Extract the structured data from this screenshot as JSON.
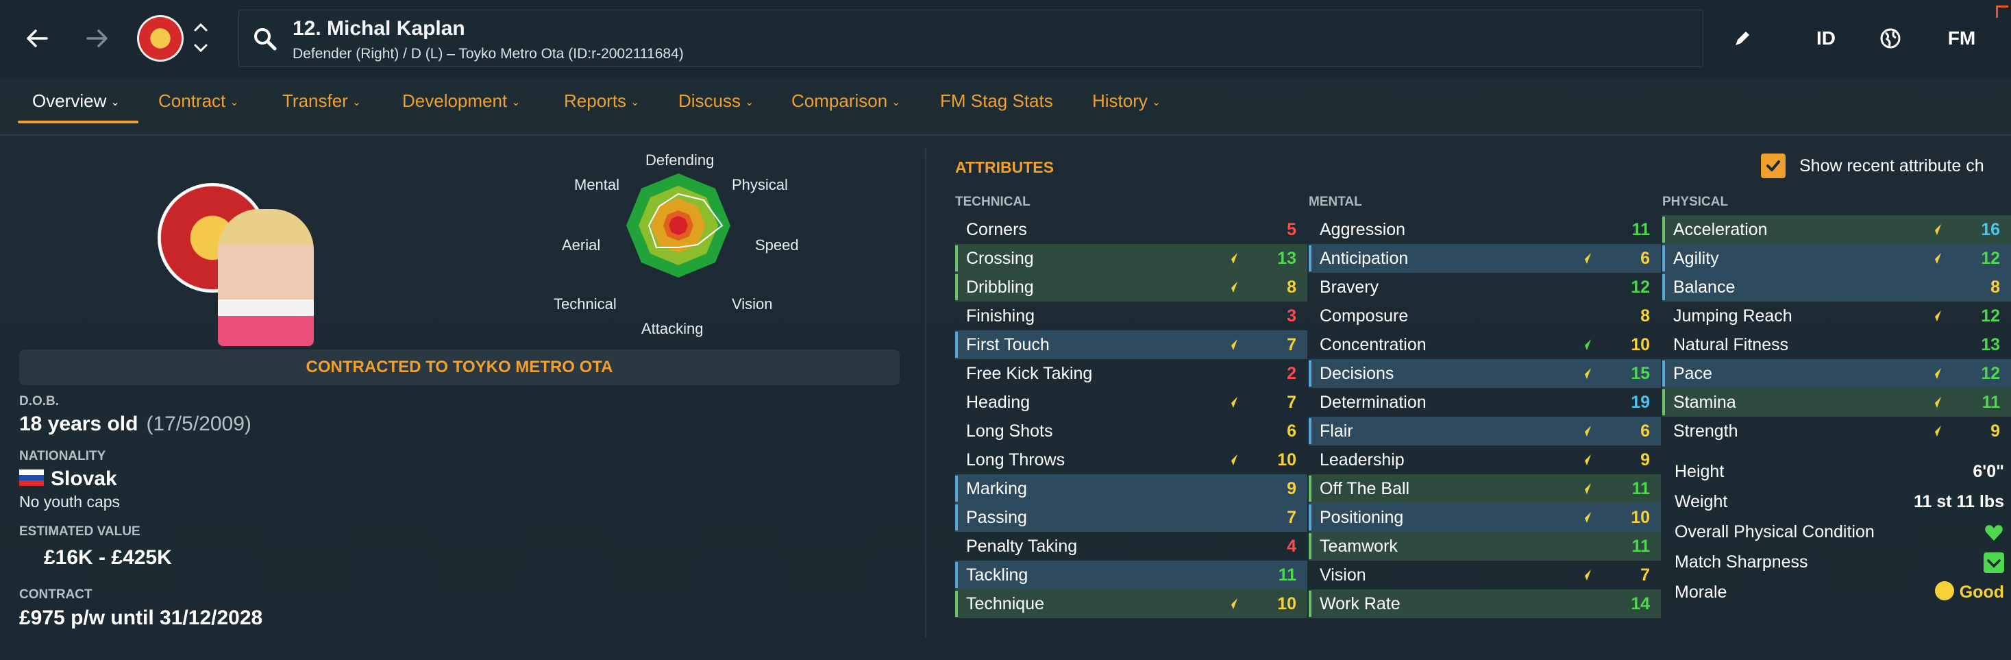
{
  "header": {
    "player_name": "12. Michal Kaplan",
    "player_subtitle": "Defender (Right) / D (L) – Toyko Metro Ota (ID:r-2002111684)",
    "id_button": "ID",
    "fm_button": "FM"
  },
  "tabs": [
    {
      "label": "Overview"
    },
    {
      "label": "Contract"
    },
    {
      "label": "Transfer"
    },
    {
      "label": "Development"
    },
    {
      "label": "Reports"
    },
    {
      "label": "Discuss"
    },
    {
      "label": "Comparison"
    },
    {
      "label": "FM Stag Stats"
    },
    {
      "label": "History"
    }
  ],
  "radar": {
    "labels": {
      "defending": "Defending",
      "physical": "Physical",
      "speed": "Speed",
      "vision": "Vision",
      "attacking": "Attacking",
      "technical": "Technical",
      "aerial": "Aerial",
      "mental": "Mental"
    }
  },
  "profile": {
    "contract_banner": "CONTRACTED TO TOYKO METRO OTA",
    "dob_label": "D.O.B.",
    "age": "18 years old",
    "dob": "(17/5/2009)",
    "nationality_label": "NATIONALITY",
    "nationality": "Slovak",
    "youth_caps": "No youth caps",
    "value_label": "ESTIMATED VALUE",
    "value": "£16K - £425K",
    "contract_label": "CONTRACT",
    "contract": "£975 p/w until 31/12/2028"
  },
  "attributes": {
    "title": "ATTRIBUTES",
    "show_recent_label": "Show recent attribute ch",
    "technical_head": "TECHNICAL",
    "mental_head": "MENTAL",
    "physical_head": "PHYSICAL",
    "technical": [
      {
        "name": "Corners",
        "value": "5",
        "color": "red",
        "hl": "",
        "arrow": ""
      },
      {
        "name": "Crossing",
        "value": "13",
        "color": "green",
        "hl": "green",
        "arrow": "up"
      },
      {
        "name": "Dribbling",
        "value": "8",
        "color": "yellow",
        "hl": "green",
        "arrow": "up"
      },
      {
        "name": "Finishing",
        "value": "3",
        "color": "red",
        "hl": "",
        "arrow": ""
      },
      {
        "name": "First Touch",
        "value": "7",
        "color": "yellow",
        "hl": "blue",
        "arrow": "up"
      },
      {
        "name": "Free Kick Taking",
        "value": "2",
        "color": "red",
        "hl": "",
        "arrow": ""
      },
      {
        "name": "Heading",
        "value": "7",
        "color": "yellow",
        "hl": "",
        "arrow": "up"
      },
      {
        "name": "Long Shots",
        "value": "6",
        "color": "yellow",
        "hl": "",
        "arrow": ""
      },
      {
        "name": "Long Throws",
        "value": "10",
        "color": "yellow",
        "hl": "",
        "arrow": "up"
      },
      {
        "name": "Marking",
        "value": "9",
        "color": "yellow",
        "hl": "blue",
        "arrow": ""
      },
      {
        "name": "Passing",
        "value": "7",
        "color": "yellow",
        "hl": "blue",
        "arrow": ""
      },
      {
        "name": "Penalty Taking",
        "value": "4",
        "color": "red",
        "hl": "",
        "arrow": ""
      },
      {
        "name": "Tackling",
        "value": "11",
        "color": "green",
        "hl": "blue",
        "arrow": ""
      },
      {
        "name": "Technique",
        "value": "10",
        "color": "yellow",
        "hl": "green",
        "arrow": "up"
      }
    ],
    "mental": [
      {
        "name": "Aggression",
        "value": "11",
        "color": "green",
        "hl": "",
        "arrow": ""
      },
      {
        "name": "Anticipation",
        "value": "6",
        "color": "yellow",
        "hl": "blue",
        "arrow": "up"
      },
      {
        "name": "Bravery",
        "value": "12",
        "color": "green",
        "hl": "",
        "arrow": ""
      },
      {
        "name": "Composure",
        "value": "8",
        "color": "yellow",
        "hl": "",
        "arrow": ""
      },
      {
        "name": "Concentration",
        "value": "10",
        "color": "yellow",
        "hl": "",
        "arrow": "upgreen"
      },
      {
        "name": "Decisions",
        "value": "15",
        "color": "green",
        "hl": "blue",
        "arrow": "up"
      },
      {
        "name": "Determination",
        "value": "19",
        "color": "blue",
        "hl": "",
        "arrow": ""
      },
      {
        "name": "Flair",
        "value": "6",
        "color": "yellow",
        "hl": "blue",
        "arrow": "up"
      },
      {
        "name": "Leadership",
        "value": "9",
        "color": "yellow",
        "hl": "",
        "arrow": "up"
      },
      {
        "name": "Off The Ball",
        "value": "11",
        "color": "green",
        "hl": "green",
        "arrow": "up"
      },
      {
        "name": "Positioning",
        "value": "10",
        "color": "yellow",
        "hl": "blue",
        "arrow": "up"
      },
      {
        "name": "Teamwork",
        "value": "11",
        "color": "green",
        "hl": "green",
        "arrow": ""
      },
      {
        "name": "Vision",
        "value": "7",
        "color": "yellow",
        "hl": "",
        "arrow": "up"
      },
      {
        "name": "Work Rate",
        "value": "14",
        "color": "green",
        "hl": "green",
        "arrow": ""
      }
    ],
    "physical": [
      {
        "name": "Acceleration",
        "value": "16",
        "color": "blue",
        "hl": "green",
        "arrow": "up"
      },
      {
        "name": "Agility",
        "value": "12",
        "color": "green",
        "hl": "blue",
        "arrow": "up"
      },
      {
        "name": "Balance",
        "value": "8",
        "color": "yellow",
        "hl": "blue",
        "arrow": ""
      },
      {
        "name": "Jumping Reach",
        "value": "12",
        "color": "green",
        "hl": "",
        "arrow": "up"
      },
      {
        "name": "Natural Fitness",
        "value": "13",
        "color": "green",
        "hl": "",
        "arrow": ""
      },
      {
        "name": "Pace",
        "value": "12",
        "color": "green",
        "hl": "blue",
        "arrow": "up"
      },
      {
        "name": "Stamina",
        "value": "11",
        "color": "green",
        "hl": "green",
        "arrow": "up"
      },
      {
        "name": "Strength",
        "value": "9",
        "color": "yellow",
        "hl": "",
        "arrow": "up"
      }
    ],
    "extra": {
      "height_label": "Height",
      "height": "6'0\"",
      "weight_label": "Weight",
      "weight": "11 st 11 lbs",
      "condition_label": "Overall Physical Condition",
      "sharpness_label": "Match Sharpness",
      "morale_label": "Morale",
      "morale": "Good"
    }
  },
  "colors": {
    "accent": "#f0a030",
    "red": "#ff4b4b",
    "yellow": "#f5d23a",
    "green": "#4fd84f",
    "blue": "#4cc4f0"
  }
}
